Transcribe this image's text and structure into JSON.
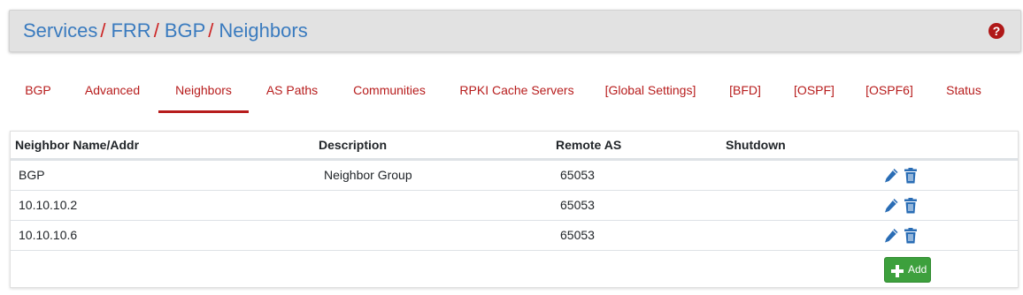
{
  "breadcrumb": {
    "items": [
      "Services",
      "FRR",
      "BGP",
      "Neighbors"
    ],
    "separator": "/"
  },
  "help_icon": "question-circle-icon",
  "tabs": [
    {
      "label": "BGP"
    },
    {
      "label": "Advanced"
    },
    {
      "label": "Neighbors",
      "active": true
    },
    {
      "label": "AS Paths"
    },
    {
      "label": "Communities"
    },
    {
      "label": "RPKI Cache Servers"
    },
    {
      "label": "[Global Settings]"
    },
    {
      "label": "[BFD]"
    },
    {
      "label": "[OSPF]"
    },
    {
      "label": "[OSPF6]"
    },
    {
      "label": "Status"
    }
  ],
  "table": {
    "columns": [
      "Neighbor Name/Addr",
      "Description",
      "Remote AS",
      "Shutdown"
    ],
    "rows": [
      {
        "name": "BGP",
        "description": "Neighbor Group",
        "remote_as": "65053",
        "shutdown": ""
      },
      {
        "name": "10.10.10.2",
        "description": "",
        "remote_as": "65053",
        "shutdown": ""
      },
      {
        "name": "10.10.10.6",
        "description": "",
        "remote_as": "65053",
        "shutdown": ""
      }
    ],
    "row_actions": [
      "pencil-icon",
      "trash-icon"
    ]
  },
  "add_button": {
    "label": "Add",
    "icon": "plus-icon"
  },
  "colors": {
    "link": "#3a7bbf",
    "tab": "#b71c1c",
    "add": "#3da03d",
    "icon": "#2a6db5"
  }
}
